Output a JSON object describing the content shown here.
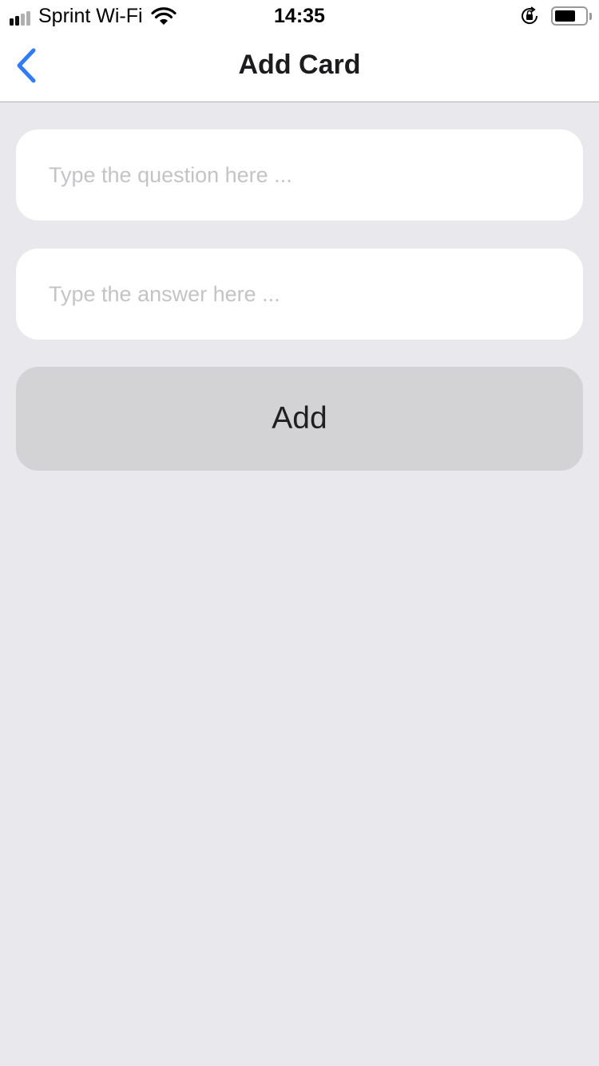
{
  "status_bar": {
    "carrier": "Sprint Wi-Fi",
    "time": "14:35",
    "signal_bars_filled": 2,
    "signal_bars_total": 4,
    "battery_level": 0.65,
    "icons": [
      "signal-icon",
      "wifi-icon",
      "orientation-lock-icon",
      "battery-icon"
    ]
  },
  "nav": {
    "title": "Add Card",
    "back_icon": "chevron-left-icon",
    "accent_color": "#2f7cf6"
  },
  "form": {
    "question_placeholder": "Type the question here ...",
    "question_value": "",
    "answer_placeholder": "Type the answer here ...",
    "answer_value": "",
    "add_label": "Add"
  },
  "colors": {
    "background": "#e9e8ed",
    "field_background": "#ffffff",
    "button_background": "#d3d3d6"
  }
}
